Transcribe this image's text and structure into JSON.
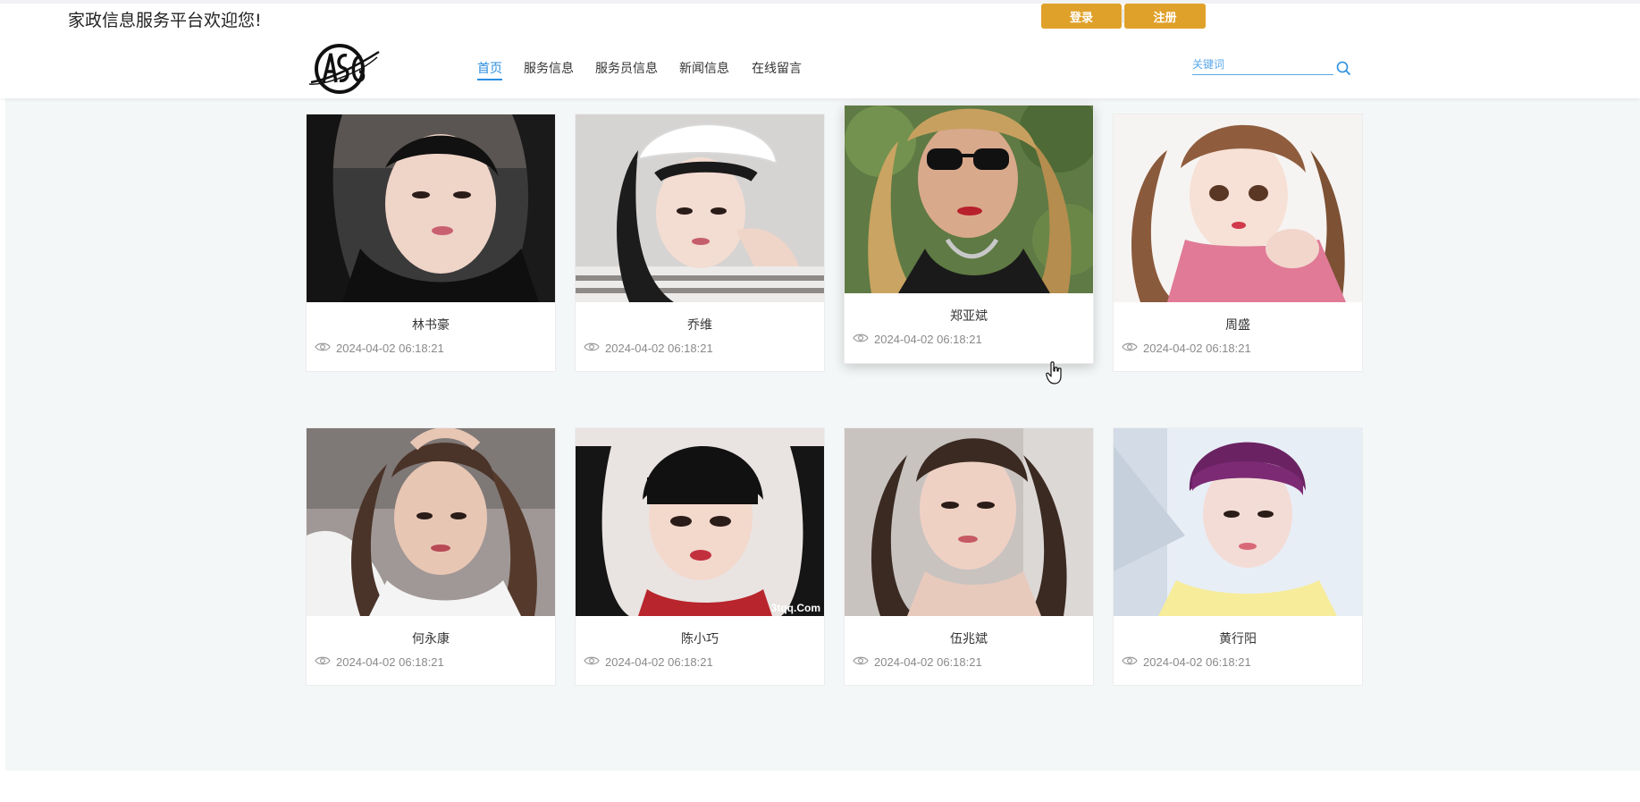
{
  "header": {
    "welcome_text": "家政信息服务平台欢迎您!",
    "login_label": "登录",
    "register_label": "注册"
  },
  "nav": {
    "items": [
      {
        "label": "首页",
        "active": true
      },
      {
        "label": "服务信息"
      },
      {
        "label": "服务员信息"
      },
      {
        "label": "新闻信息"
      },
      {
        "label": "在线留言"
      }
    ]
  },
  "search": {
    "placeholder": "关键词",
    "icon": "search-icon"
  },
  "cards": [
    {
      "name": "林书豪",
      "date": "2024-04-02 06:18:21"
    },
    {
      "name": "乔维",
      "date": "2024-04-02 06:18:21"
    },
    {
      "name": "郑亚斌",
      "date": "2024-04-02 06:18:21"
    },
    {
      "name": "周盛",
      "date": "2024-04-02 06:18:21"
    },
    {
      "name": "何永康",
      "date": "2024-04-02 06:18:21"
    },
    {
      "name": "陈小巧",
      "date": "2024-04-02 06:18:21",
      "watermark": "3tqq.Com"
    },
    {
      "name": "伍兆斌",
      "date": "2024-04-02 06:18:21"
    },
    {
      "name": "黄行阳",
      "date": "2024-04-02 06:18:21"
    }
  ],
  "colors": {
    "accent": "#2a8ee0",
    "button": "#e0a12a",
    "content_bg": "#f4f7f8"
  }
}
